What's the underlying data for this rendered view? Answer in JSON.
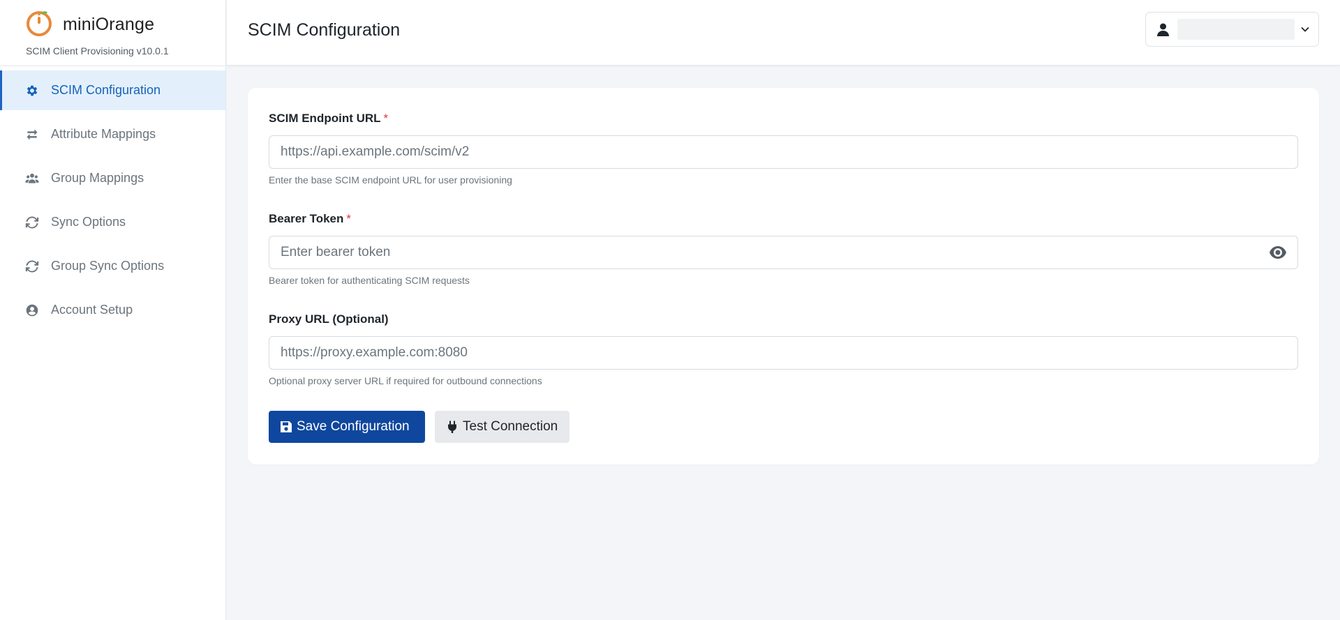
{
  "brand": {
    "name": "miniOrange",
    "version": "SCIM Client Provisioning v10.0.1"
  },
  "sidebar": {
    "items": [
      {
        "label": "SCIM Configuration",
        "icon": "gear-icon",
        "active": true
      },
      {
        "label": "Attribute Mappings",
        "icon": "arrows-exchange-icon",
        "active": false
      },
      {
        "label": "Group Mappings",
        "icon": "users-icon",
        "active": false
      },
      {
        "label": "Sync Options",
        "icon": "sync-icon",
        "active": false
      },
      {
        "label": "Group Sync Options",
        "icon": "sync-icon",
        "active": false
      },
      {
        "label": "Account Setup",
        "icon": "user-circle-icon",
        "active": false
      }
    ]
  },
  "header": {
    "title": "SCIM Configuration",
    "user_menu": {
      "icon": "user-icon",
      "name": "",
      "chevron": "chevron-down-icon"
    }
  },
  "form": {
    "endpoint": {
      "label": "SCIM Endpoint URL",
      "required_mark": "*",
      "value": "",
      "placeholder": "https://api.example.com/scim/v2",
      "help": "Enter the base SCIM endpoint URL for user provisioning"
    },
    "token": {
      "label": "Bearer Token",
      "required_mark": "*",
      "value": "",
      "placeholder": "Enter bearer token",
      "help": "Bearer token for authenticating SCIM requests",
      "toggle_icon": "eye-icon"
    },
    "proxy": {
      "label": "Proxy URL (Optional)",
      "value": "",
      "placeholder": "https://proxy.example.com:8080",
      "help": "Optional proxy server URL if required for outbound connections"
    },
    "save_label": "Save Configuration",
    "save_icon": "save-icon",
    "test_label": "Test Connection",
    "test_icon": "plug-icon"
  },
  "colors": {
    "accent": "#1562b8",
    "primary_button": "#0f479e",
    "active_nav_bg": "#e3f0fc",
    "required": "#dc3545",
    "brand_orange": "#e8893a"
  }
}
